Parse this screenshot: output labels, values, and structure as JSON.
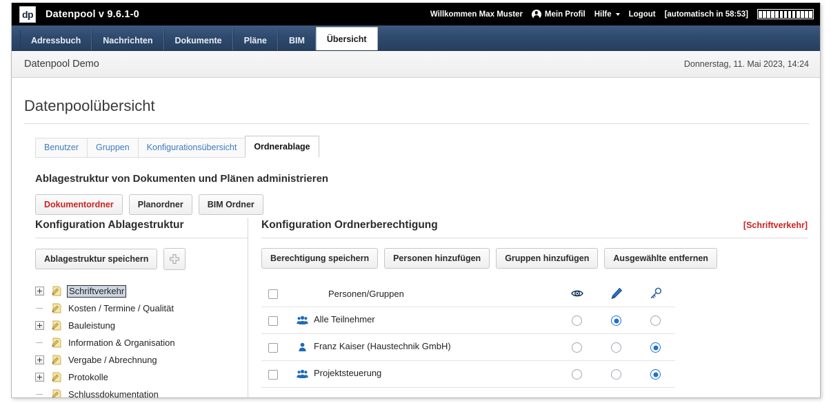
{
  "topbar": {
    "logo_text": "dp",
    "app_title": "Datenpool v 9.6.1-0",
    "welcome": "Willkommen Max Muster",
    "profile": "Mein Profil",
    "help": "Hilfe",
    "logout": "Logout",
    "session": "[automatisch in 58:53]",
    "timer_segments": 13
  },
  "nav_tabs": [
    {
      "label": "Adressbuch",
      "active": false
    },
    {
      "label": "Nachrichten",
      "active": false
    },
    {
      "label": "Dokumente",
      "active": false
    },
    {
      "label": "Pläne",
      "active": false
    },
    {
      "label": "BIM",
      "active": false
    },
    {
      "label": "Übersicht",
      "active": true
    }
  ],
  "subheader": {
    "pool_name": "Datenpool Demo",
    "date": "Donnerstag, 11. Mai 2023, 14:24"
  },
  "page": {
    "title": "Datenpoolübersicht",
    "section_heading": "Ablagestruktur von Dokumenten und Plänen administrieren"
  },
  "subtabs": [
    {
      "label": "Benutzer",
      "active": false
    },
    {
      "label": "Gruppen",
      "active": false
    },
    {
      "label": "Konfigurationsübersicht",
      "active": false
    },
    {
      "label": "Ordnerablage",
      "active": true
    }
  ],
  "folder_type_buttons": [
    {
      "label": "Dokumentordner",
      "active": true
    },
    {
      "label": "Planordner",
      "active": false
    },
    {
      "label": "BIM Ordner",
      "active": false
    }
  ],
  "left_panel": {
    "heading": "Konfiguration Ablagestruktur",
    "save_label": "Ablagestruktur speichern",
    "add_icon": "plus-icon",
    "tree": [
      {
        "label": "Schriftverkehr",
        "expandable": true,
        "selected": true
      },
      {
        "label": "Kosten / Termine / Qualität",
        "expandable": false,
        "selected": false
      },
      {
        "label": "Bauleistung",
        "expandable": true,
        "selected": false
      },
      {
        "label": "Information & Organisation",
        "expandable": false,
        "selected": false
      },
      {
        "label": "Vergabe / Abrechnung",
        "expandable": true,
        "selected": false
      },
      {
        "label": "Protokolle",
        "expandable": true,
        "selected": false
      },
      {
        "label": "Schlussdokumentation",
        "expandable": false,
        "selected": false
      }
    ]
  },
  "right_panel": {
    "heading": "Konfiguration Ordnerberechtigung",
    "current_folder": "[Schriftverkehr]",
    "buttons": [
      {
        "label": "Berechtigung speichern"
      },
      {
        "label": "Personen hinzufügen"
      },
      {
        "label": "Gruppen hinzufügen"
      },
      {
        "label": "Ausgewählte entfernen"
      }
    ],
    "table": {
      "header_label": "Personen/Gruppen",
      "permission_icons": [
        "eye-icon",
        "pencil-icon",
        "key-icon"
      ],
      "rows": [
        {
          "name": "Alle Teilnehmer",
          "type": "group",
          "checked": false,
          "permission": 1
        },
        {
          "name": "Franz Kaiser (Haustechnik GmbH)",
          "type": "person",
          "checked": false,
          "permission": 2
        },
        {
          "name": "Projektsteuerung",
          "type": "group",
          "checked": false,
          "permission": 2
        }
      ]
    }
  },
  "colors": {
    "accent_blue": "#1a72d0",
    "nav_dark": "#2f4a6e",
    "alert_red": "#cc2222",
    "link_blue": "#3f7bbf",
    "folder_yellow": "#f5e3a4"
  }
}
